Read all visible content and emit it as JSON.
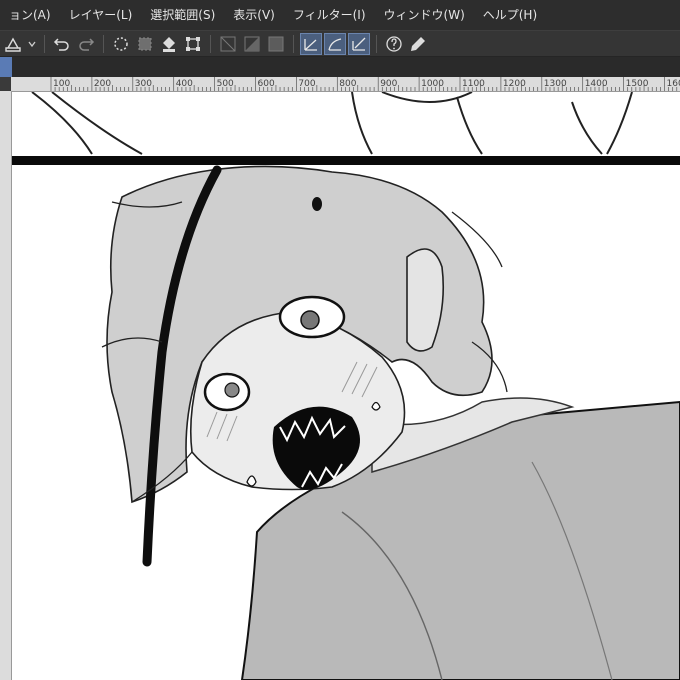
{
  "menu": {
    "items": [
      "ョン(A)",
      "レイヤー(L)",
      "選択範囲(S)",
      "表示(V)",
      "フィルター(I)",
      "ウィンドウ(W)",
      "ヘルプ(H)"
    ]
  },
  "toolbar": {
    "icons": [
      "ruler-icon",
      "chevron-down-icon",
      "undo-icon",
      "redo-icon",
      "clear-selection-icon",
      "fill-selection-icon",
      "fill-icon",
      "transform-icon",
      "line-icon-dim-1",
      "line-icon-dim-2",
      "line-icon-dim-3",
      "vector-icon-1",
      "vector-icon-2",
      "vector-icon-3",
      "help-icon",
      "pen-icon"
    ]
  },
  "ruler": {
    "labels": [
      "100",
      "200",
      "300",
      "400",
      "500",
      "600",
      "700",
      "800",
      "900",
      "1000",
      "1100",
      "1200",
      "1300",
      "1400",
      "1500",
      "160"
    ]
  },
  "colors": {
    "menubar": "#2d2d2d",
    "toolbar": "#353535",
    "active_tool": "#4b5f7e",
    "tab_handle": "#5a7bb5",
    "ruler": "#dcdcdc",
    "canvas": "#ffffff"
  }
}
